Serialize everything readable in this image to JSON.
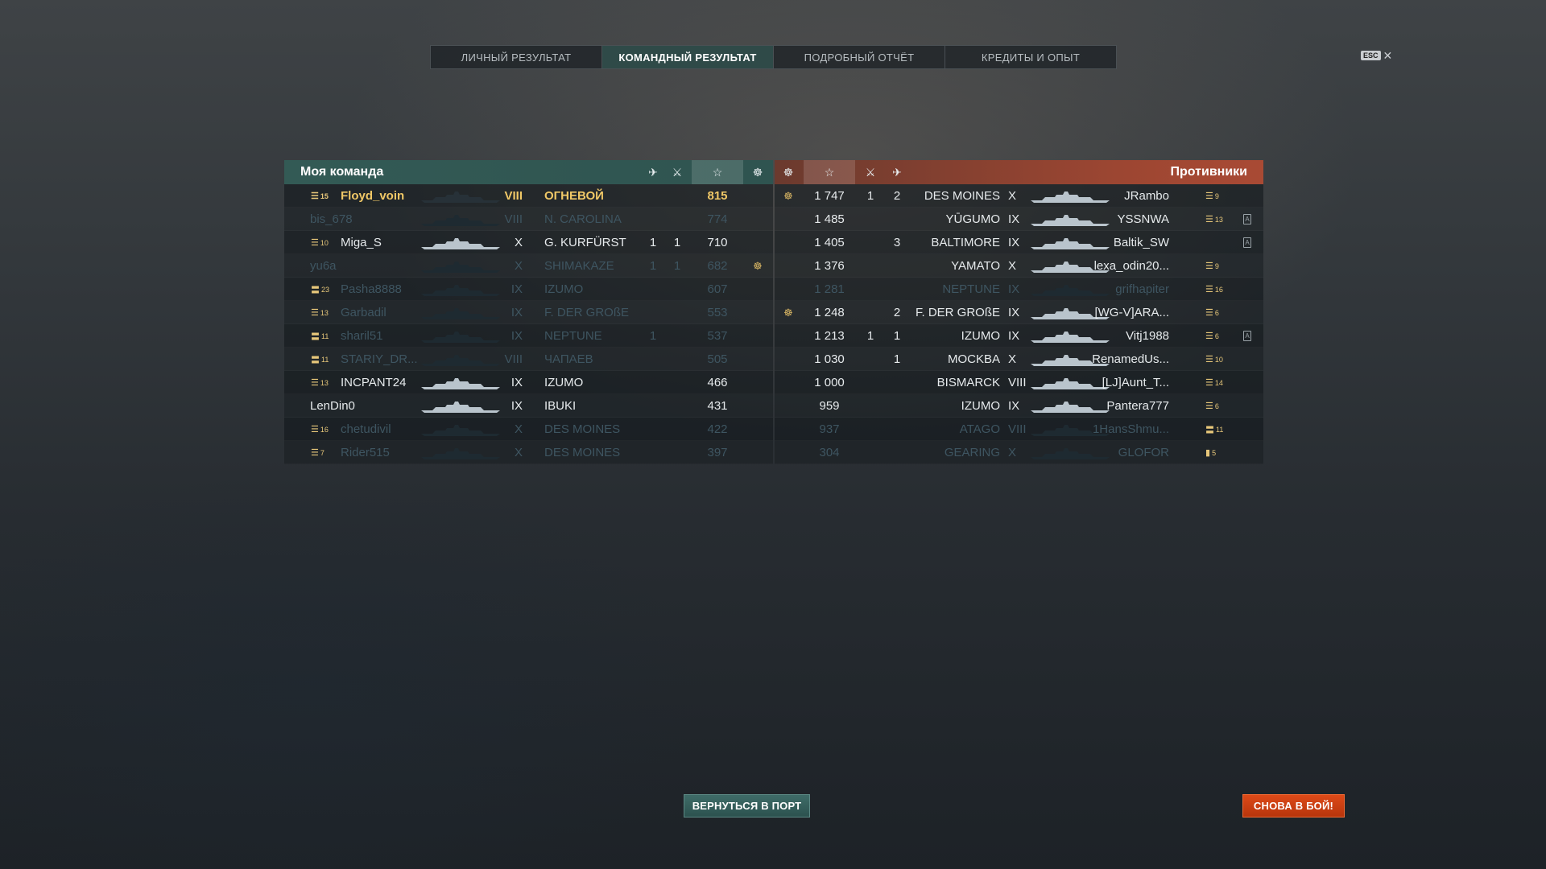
{
  "tabs": [
    "ЛИЧНЫЙ РЕЗУЛЬТАТ",
    "КОМАНДНЫЙ РЕЗУЛЬТАТ",
    "ПОДРОБНЫЙ ОТЧЁТ",
    "КРЕДИТЫ И ОПЫТ"
  ],
  "active_tab": 1,
  "esc": {
    "key": "ESC",
    "close": "✕"
  },
  "my_team": {
    "title": "Моя команда",
    "header_icons": [
      "plane-icon",
      "crossed-swords-icon",
      "star-icon",
      "medal-icon"
    ],
    "players": [
      {
        "rank_icon": "rank-3-stripes",
        "rank": "15",
        "name": "Floyd_voin",
        "tier": "VIII",
        "ship": "ОГНЕВОЙ",
        "planes": "",
        "kills": "",
        "xp": "815",
        "medal": "",
        "state": "self"
      },
      {
        "rank_icon": "",
        "rank": "",
        "name": "bis_678",
        "tier": "VIII",
        "ship": "N. CAROLINA",
        "planes": "",
        "kills": "",
        "xp": "774",
        "medal": "",
        "state": "dead"
      },
      {
        "rank_icon": "rank-3-stripes",
        "rank": "10",
        "name": "Miga_S",
        "tier": "X",
        "ship": "G. KURFÜRST",
        "planes": "1",
        "kills": "1",
        "xp": "710",
        "medal": "",
        "state": "alive"
      },
      {
        "rank_icon": "",
        "rank": "",
        "name": "yu6a",
        "tier": "X",
        "ship": "SHIMAKAZE",
        "planes": "1",
        "kills": "1",
        "xp": "682",
        "medal": "medal",
        "state": "dead"
      },
      {
        "rank_icon": "rank-2-stripes",
        "rank": "23",
        "name": "Pasha8888",
        "tier": "IX",
        "ship": "IZUMO",
        "planes": "",
        "kills": "",
        "xp": "607",
        "medal": "",
        "state": "dead"
      },
      {
        "rank_icon": "rank-3-stripes",
        "rank": "13",
        "name": "Garbadil",
        "tier": "IX",
        "ship": "F. DER GROßE",
        "planes": "",
        "kills": "",
        "xp": "553",
        "medal": "",
        "state": "dead"
      },
      {
        "rank_icon": "rank-2-stripes",
        "rank": "11",
        "name": "sharil51",
        "tier": "IX",
        "ship": "NEPTUNE",
        "planes": "1",
        "kills": "",
        "xp": "537",
        "medal": "",
        "state": "dead"
      },
      {
        "rank_icon": "rank-2-stripes",
        "rank": "11",
        "name": "STARIY_DR...",
        "tier": "VIII",
        "ship": "ЧАПАЕВ",
        "planes": "",
        "kills": "",
        "xp": "505",
        "medal": "",
        "state": "dead"
      },
      {
        "rank_icon": "rank-3-stripes",
        "rank": "13",
        "name": "INCPANT24",
        "tier": "IX",
        "ship": "IZUMO",
        "planes": "",
        "kills": "",
        "xp": "466",
        "medal": "",
        "state": "alive"
      },
      {
        "rank_icon": "",
        "rank": "",
        "name": "LenDin0",
        "tier": "IX",
        "ship": "IBUKI",
        "planes": "",
        "kills": "",
        "xp": "431",
        "medal": "",
        "state": "alive"
      },
      {
        "rank_icon": "rank-3-stripes",
        "rank": "16",
        "name": "chetudivil",
        "tier": "X",
        "ship": "DES MOINES",
        "planes": "",
        "kills": "",
        "xp": "422",
        "medal": "",
        "state": "dead"
      },
      {
        "rank_icon": "rank-3-stripes",
        "rank": "7",
        "name": "Rider515",
        "tier": "X",
        "ship": "DES MOINES",
        "planes": "",
        "kills": "",
        "xp": "397",
        "medal": "",
        "state": "dead"
      }
    ]
  },
  "enemy_team": {
    "title": "Противники",
    "header_icons": [
      "medal-icon",
      "star-icon",
      "crossed-swords-icon",
      "plane-icon"
    ],
    "players": [
      {
        "medal": "medal",
        "xp": "1 747",
        "kills": "1",
        "planes": "2",
        "ship": "DES MOINES",
        "tier": "X",
        "name": "JRambo",
        "rank_icon": "rank-3-stripes",
        "rank": "9",
        "badge": "",
        "state": "alive"
      },
      {
        "medal": "",
        "xp": "1 485",
        "kills": "",
        "planes": "",
        "ship": "YŪGUMO",
        "tier": "IX",
        "name": "YSSNWA",
        "rank_icon": "rank-3-stripes",
        "rank": "13",
        "badge": "A",
        "state": "alive"
      },
      {
        "medal": "",
        "xp": "1 405",
        "kills": "",
        "planes": "3",
        "ship": "BALTIMORE",
        "tier": "IX",
        "name": "Baltik_SW",
        "rank_icon": "",
        "rank": "",
        "badge": "A",
        "state": "alive"
      },
      {
        "medal": "",
        "xp": "1 376",
        "kills": "",
        "planes": "",
        "ship": "YAMATO",
        "tier": "X",
        "name": "lexa_odin20...",
        "rank_icon": "rank-3-stripes",
        "rank": "9",
        "badge": "",
        "state": "alive"
      },
      {
        "medal": "",
        "xp": "1 281",
        "kills": "",
        "planes": "",
        "ship": "NEPTUNE",
        "tier": "IX",
        "name": "grifhapiter",
        "rank_icon": "rank-3-stripes",
        "rank": "16",
        "badge": "",
        "state": "dead"
      },
      {
        "medal": "medal",
        "xp": "1 248",
        "kills": "",
        "planes": "2",
        "ship": "F. DER GROßE",
        "tier": "IX",
        "name": "[WG-V]ARA...",
        "rank_icon": "rank-3-stripes",
        "rank": "6",
        "badge": "",
        "state": "alive"
      },
      {
        "medal": "",
        "xp": "1 213",
        "kills": "1",
        "planes": "1",
        "ship": "IZUMO",
        "tier": "IX",
        "name": "Vitj1988",
        "rank_icon": "rank-3-stripes",
        "rank": "6",
        "badge": "A",
        "state": "alive"
      },
      {
        "medal": "",
        "xp": "1 030",
        "kills": "",
        "planes": "1",
        "ship": "MOCKBA",
        "tier": "X",
        "name": "RenamedUs...",
        "rank_icon": "rank-3-stripes",
        "rank": "10",
        "badge": "",
        "state": "alive"
      },
      {
        "medal": "",
        "xp": "1 000",
        "kills": "",
        "planes": "",
        "ship": "BISMARCK",
        "tier": "VIII",
        "name": "[LJ]Aunt_T...",
        "rank_icon": "rank-3-stripes",
        "rank": "14",
        "badge": "",
        "state": "alive"
      },
      {
        "medal": "",
        "xp": "959",
        "kills": "",
        "planes": "",
        "ship": "IZUMO",
        "tier": "IX",
        "name": "Pantera777",
        "rank_icon": "rank-3-stripes",
        "rank": "6",
        "badge": "",
        "state": "alive"
      },
      {
        "medal": "",
        "xp": "937",
        "kills": "",
        "planes": "",
        "ship": "ATAGO",
        "tier": "VIII",
        "name": "1HansShmu...",
        "rank_icon": "rank-2-stripes",
        "rank": "11",
        "badge": "",
        "state": "dead"
      },
      {
        "medal": "",
        "xp": "304",
        "kills": "",
        "planes": "",
        "ship": "GEARING",
        "tier": "X",
        "name": "GLOFOR",
        "rank_icon": "rank-bar",
        "rank": "5",
        "badge": "",
        "state": "dead"
      }
    ]
  },
  "buttons": {
    "return_port": "ВЕРНУТЬСЯ В ПОРТ",
    "battle_again": "СНОВА В БОЙ!"
  }
}
